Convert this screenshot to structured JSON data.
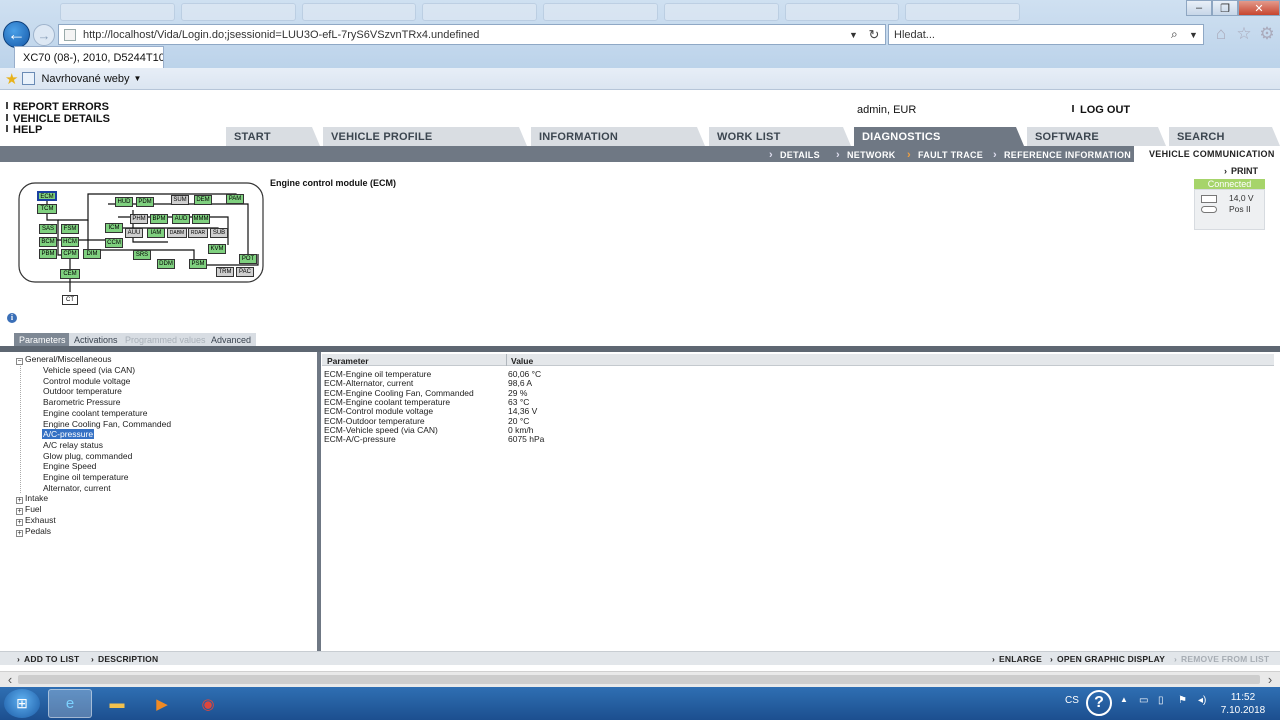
{
  "browser": {
    "url": "http://localhost/Vida/Login.do;jsessionid=LUU3O-efL-7ryS6VSzvnTRx4.undefined",
    "search_placeholder": "Hledat...",
    "active_tab_title": "XC70 (08-), 2010, D5244T10...",
    "favorites_label": "Navrhované weby"
  },
  "topmenu": {
    "items": [
      "REPORT ERRORS",
      "VEHICLE DETAILS",
      "HELP"
    ],
    "user": "admin, EUR",
    "logout": "LOG OUT"
  },
  "nav": {
    "tabs": [
      "START",
      "VEHICLE PROFILE",
      "INFORMATION",
      "WORK LIST",
      "DIAGNOSTICS",
      "SOFTWARE",
      "SEARCH"
    ],
    "active": "DIAGNOSTICS",
    "subitems": [
      "DETAILS",
      "NETWORK",
      "FAULT TRACE",
      "REFERENCE INFORMATION"
    ],
    "subitem_active": "VEHICLE COMMUNICATION"
  },
  "diagram": {
    "title": "Engine control module (ECM)",
    "print": "PRINT",
    "status": "Connected",
    "voltage": "14,0 V",
    "position": "Pos II",
    "modules": [
      "ECM",
      "TCM",
      "SAS",
      "FSM",
      "BCM",
      "HCM",
      "PBM",
      "CPM",
      "DIM",
      "CEM",
      "CT",
      "HUD",
      "PDM",
      "SUM",
      "DEM",
      "PAM",
      "PHM",
      "BPM",
      "AUD",
      "MMM",
      "ICM",
      "AUU",
      "IAM",
      "DABM",
      "RDAR",
      "SUB",
      "CCM",
      "SRS",
      "DDM",
      "KVM",
      "POT",
      "PSM",
      "TRM",
      "PAC"
    ]
  },
  "panel_tabs": {
    "items": [
      "Parameters",
      "Activations",
      "Programmed values",
      "Advanced"
    ],
    "active": "Parameters",
    "disabled": "Programmed values"
  },
  "tree": {
    "root": "General/Miscellaneous",
    "leaves": [
      "Vehicle speed (via CAN)",
      "Control module voltage",
      "Outdoor temperature",
      "Barometric Pressure",
      "Engine coolant temperature",
      "Engine Cooling Fan, Commanded",
      "A/C-pressure",
      "A/C relay status",
      "Glow plug, commanded",
      "Engine Speed",
      "Engine oil temperature",
      "Alternator, current"
    ],
    "selected": "A/C-pressure",
    "collapsed": [
      "Intake",
      "Fuel",
      "Exhaust",
      "Pedals"
    ]
  },
  "values_table": {
    "headers": [
      "Parameter",
      "Value"
    ],
    "rows": [
      [
        "ECM-Engine oil temperature",
        "60,06 °C"
      ],
      [
        "ECM-Alternator, current",
        "98,6 A"
      ],
      [
        "ECM-Engine Cooling Fan, Commanded",
        "29 %"
      ],
      [
        "ECM-Engine coolant temperature",
        "63 °C"
      ],
      [
        "ECM-Control module voltage",
        "14,36 V"
      ],
      [
        "ECM-Outdoor temperature",
        "20 °C"
      ],
      [
        "ECM-Vehicle speed (via CAN)",
        "0 km/h"
      ],
      [
        "ECM-A/C-pressure",
        "6075 hPa"
      ]
    ]
  },
  "bottom_bar": {
    "add_to_list": "ADD TO LIST",
    "description": "DESCRIPTION",
    "enlarge": "ENLARGE",
    "open_graphic": "OPEN GRAPHIC DISPLAY",
    "remove": "REMOVE FROM LIST"
  },
  "taskbar": {
    "lang": "CS",
    "time": "11:52",
    "date": "7.10.2018"
  },
  "colors": {
    "nav_dark": "#6f7884",
    "module_green": "#7fd07f",
    "connected": "#a6d46a",
    "selection": "#3571c4"
  }
}
